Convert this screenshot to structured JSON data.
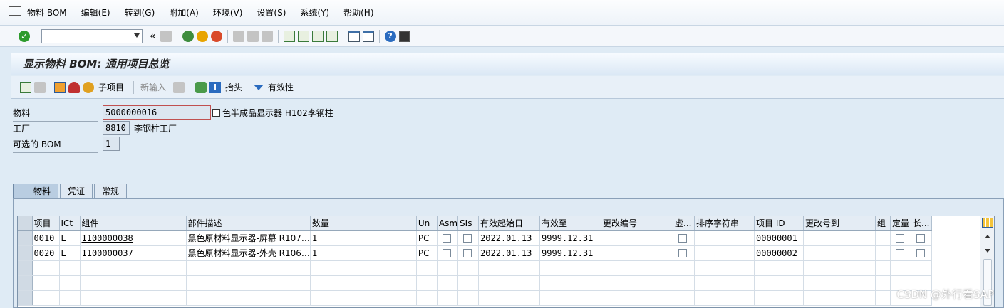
{
  "menu": [
    "物料 BOM",
    "编辑(E)",
    "转到(G)",
    "附加(A)",
    "环境(V)",
    "设置(S)",
    "系统(Y)",
    "帮助(H)"
  ],
  "command_field": {
    "value": ""
  },
  "screen_title": "显示物料 BOM: 通用项目总览",
  "app_toolbar": {
    "subitem": "子项目",
    "new_entry": "新输入",
    "header": "抬头",
    "validity": "有效性"
  },
  "form": {
    "material_label": "物料",
    "material_value": "5000000016",
    "material_desc": "色半成品显示器 H102李钢柱",
    "plant_label": "工厂",
    "plant_value": "8810",
    "plant_desc": "李钢柱工厂",
    "altbom_label": "可选的 BOM",
    "altbom_value": "1"
  },
  "tabs": [
    "物料",
    "凭证",
    "常规"
  ],
  "table": {
    "columns": [
      "项目",
      "ICt",
      "组件",
      "部件描述",
      "数量",
      "Un",
      "Asm",
      "SIs",
      "有效起始日",
      "有效至",
      "更改编号",
      "虚...",
      "排序字符串",
      "项目 ID",
      "更改号到",
      "组",
      "定量",
      "长..."
    ],
    "rows": [
      {
        "item": "0010",
        "ict": "L",
        "component": "1100000038",
        "desc": "黑色原材料显示器-屏幕 R107…",
        "qty": "1",
        "un": "PC",
        "valid_from": "2022.01.13",
        "valid_to": "9999.12.31",
        "change_no": "",
        "sort": "",
        "item_id": "00000001",
        "change_to": "",
        "group": ""
      },
      {
        "item": "0020",
        "ict": "L",
        "component": "1100000037",
        "desc": "黑色原材料显示器-外壳 R106…",
        "qty": "1",
        "un": "PC",
        "valid_from": "2022.01.13",
        "valid_to": "9999.12.31",
        "change_no": "",
        "sort": "",
        "item_id": "00000002",
        "change_to": "",
        "group": ""
      }
    ],
    "empty_rows": 3
  },
  "watermark": "CSDN @外行看SAP"
}
